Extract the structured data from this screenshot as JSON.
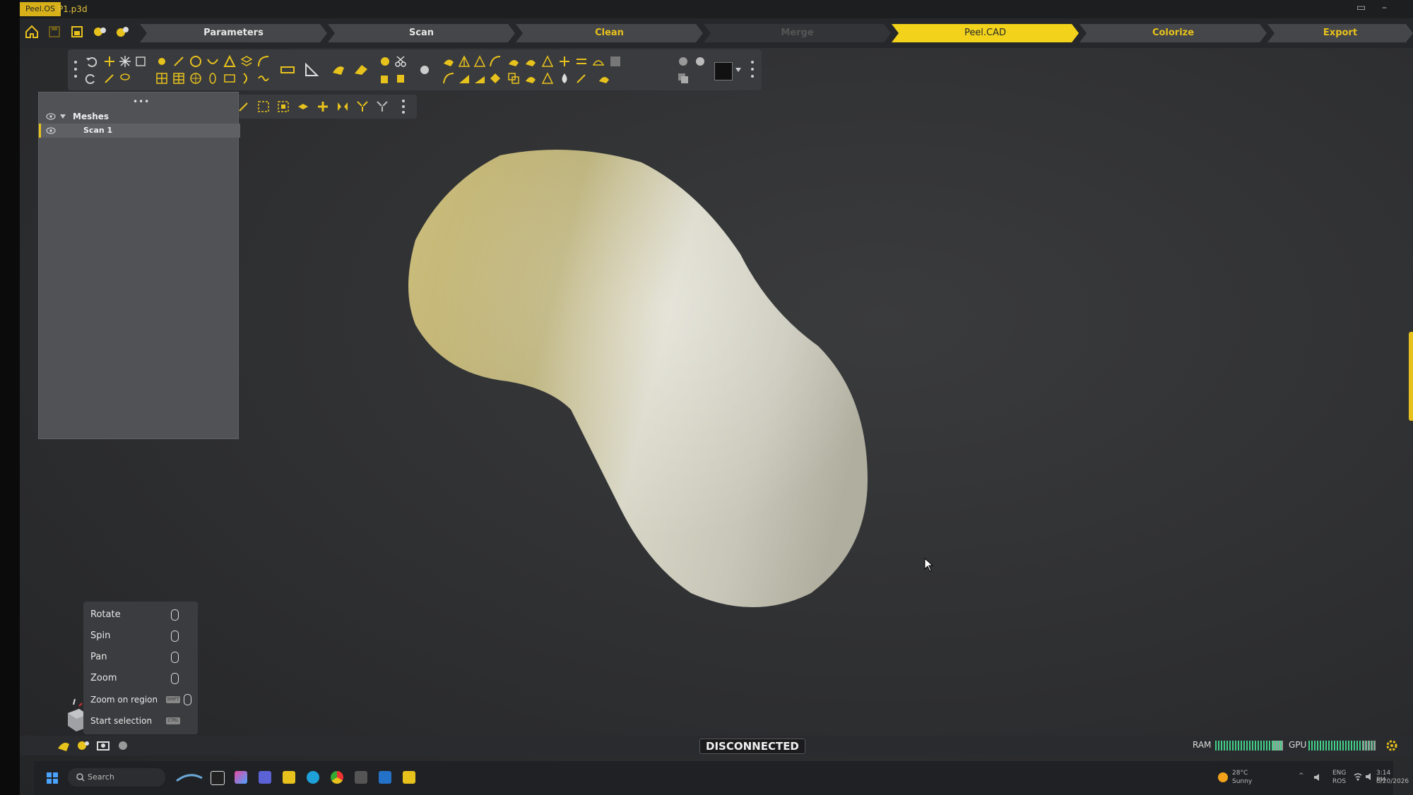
{
  "title_bar": {
    "app": "Peel.OS",
    "file": "P1.p3d"
  },
  "workflow": {
    "steps": [
      {
        "label": "Parameters",
        "state": "normal"
      },
      {
        "label": "Scan",
        "state": "normal"
      },
      {
        "label": "Clean",
        "state": "current"
      },
      {
        "label": "Merge",
        "state": "disabled"
      },
      {
        "label": "Peel.CAD",
        "state": "active"
      },
      {
        "label": "Colorize",
        "state": "highlight"
      },
      {
        "label": "Export",
        "state": "highlight"
      }
    ]
  },
  "layers": {
    "group_label": "Meshes",
    "items": [
      {
        "label": "Scan 1",
        "selected": true
      }
    ]
  },
  "controls": {
    "items": [
      {
        "label": "Rotate",
        "hint": "left-mouse-icon"
      },
      {
        "label": "Spin",
        "hint": "left-mouse-icon"
      },
      {
        "label": "Pan",
        "hint": "middle-mouse-icon"
      },
      {
        "label": "Zoom",
        "hint": "wheel-mouse-icon"
      },
      {
        "label": "Zoom on region",
        "hint": "shift-key",
        "key": "SHIFT"
      },
      {
        "label": "Start selection",
        "hint": "ctrl-key",
        "key": "CTRL"
      }
    ]
  },
  "status": {
    "connection": "DISCONNECTED",
    "ram_label": "RAM",
    "gpu_label": "GPU",
    "ram_usage": 0.15,
    "gpu_usage": 0.2
  },
  "taskbar": {
    "search_placeholder": "Search",
    "weather_temp": "28°C",
    "weather_desc": "Sunny",
    "lang_1": "ENG",
    "lang_2": "ROS",
    "time": "3:14 PM",
    "date": "8/20/2026"
  },
  "colors": {
    "accent": "#f2d21a",
    "panel": "#505256",
    "toolbar": "#3a3b3e",
    "meter": "#43d08a"
  }
}
